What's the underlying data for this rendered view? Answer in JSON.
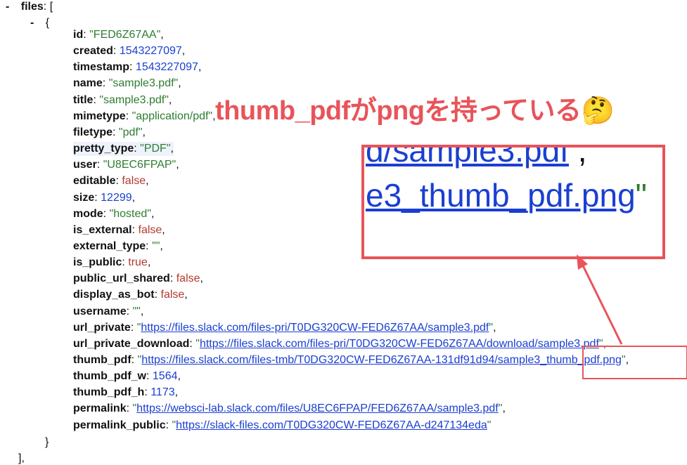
{
  "top": {
    "toggle": "-",
    "files_key": "files",
    "files_open": ": [",
    "item_toggle": "-",
    "item_open": "{",
    "item_close": "}",
    "files_close": "],"
  },
  "fields": [
    {
      "key": "id",
      "value": "\"FED6Z67AA\"",
      "kind": "str"
    },
    {
      "key": "created",
      "value": "1543227097",
      "kind": "num"
    },
    {
      "key": "timestamp",
      "value": "1543227097",
      "kind": "num"
    },
    {
      "key": "name",
      "value": "\"sample3.pdf\"",
      "kind": "str"
    },
    {
      "key": "title",
      "value": "\"sample3.pdf\"",
      "kind": "str"
    },
    {
      "key": "mimetype",
      "value": "\"application/pdf\"",
      "kind": "str"
    },
    {
      "key": "filetype",
      "value": "\"pdf\"",
      "kind": "str"
    },
    {
      "key": "pretty_type",
      "value": "\"PDF\"",
      "kind": "str"
    },
    {
      "key": "user",
      "value": "\"U8EC6FPAP\"",
      "kind": "str"
    },
    {
      "key": "editable",
      "value": "false",
      "kind": "bool"
    },
    {
      "key": "size",
      "value": "12299",
      "kind": "num"
    },
    {
      "key": "mode",
      "value": "\"hosted\"",
      "kind": "str"
    },
    {
      "key": "is_external",
      "value": "false",
      "kind": "bool"
    },
    {
      "key": "external_type",
      "value": "\"\"",
      "kind": "str"
    },
    {
      "key": "is_public",
      "value": "true",
      "kind": "bool"
    },
    {
      "key": "public_url_shared",
      "value": "false",
      "kind": "bool"
    },
    {
      "key": "display_as_bot",
      "value": "false",
      "kind": "bool"
    },
    {
      "key": "username",
      "value": "\"\"",
      "kind": "str"
    },
    {
      "key": "url_private",
      "value": "https://files.slack.com/files-pri/T0DG320CW-FED6Z67AA/sample3.pdf",
      "kind": "url"
    },
    {
      "key": "url_private_download",
      "value": "https://files.slack.com/files-pri/T0DG320CW-FED6Z67AA/download/sample3.pdf",
      "kind": "url"
    },
    {
      "key": "thumb_pdf",
      "value": "https://files.slack.com/files-tmb/T0DG320CW-FED6Z67AA-131df91d94/sample3_thumb_pdf.png",
      "kind": "url"
    },
    {
      "key": "thumb_pdf_w",
      "value": "1564",
      "kind": "num"
    },
    {
      "key": "thumb_pdf_h",
      "value": "1173",
      "kind": "num"
    },
    {
      "key": "permalink",
      "value": "https://websci-lab.slack.com/files/U8EC6FPAP/FED6Z67AA/sample3.pdf",
      "kind": "url"
    },
    {
      "key": "permalink_public",
      "value": "https://slack-files.com/T0DG320CW-FED6Z67AA-d247134eda",
      "kind": "url"
    }
  ],
  "annotation": {
    "title": "thumb_pdfがpngを持っている🤔",
    "zoom_line1": "d/sample3.pdf",
    "zoom_line1_tail": " ,",
    "zoom_line2": "e3_thumb_pdf.png",
    "zoom_line2_tail": "\"",
    "accent_color": "#e8545a"
  },
  "colors": {
    "string": "#2e7d32",
    "number": "#1a3fd1",
    "boolean": "#b23a2e",
    "link": "#1a3fd1"
  }
}
